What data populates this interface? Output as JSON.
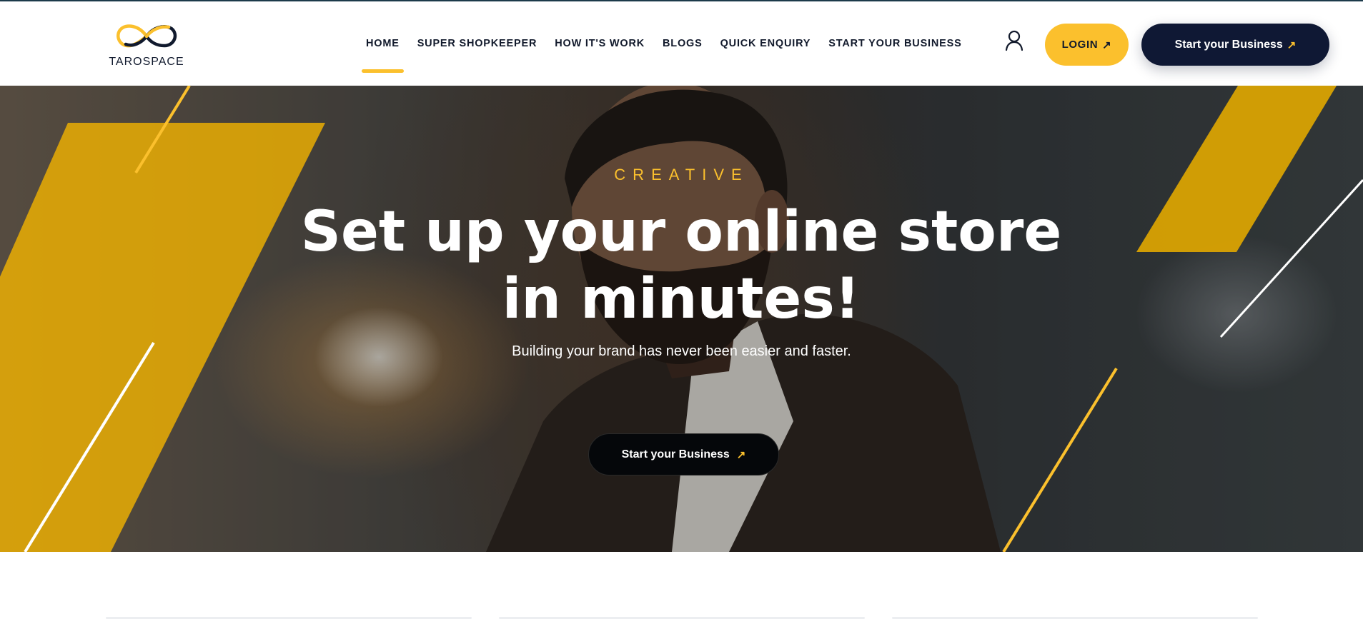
{
  "brand": {
    "name": "TAROSPACE",
    "colors": {
      "accent": "#fbc02d",
      "navy": "#0f1834"
    }
  },
  "nav": {
    "items": [
      {
        "label": "HOME",
        "active": true
      },
      {
        "label": "SUPER SHOPKEEPER",
        "active": false
      },
      {
        "label": "HOW IT'S WORK",
        "active": false
      },
      {
        "label": "BLOGS",
        "active": false
      },
      {
        "label": "QUICK ENQUIRY",
        "active": false
      },
      {
        "label": "START YOUR BUSINESS",
        "active": false
      }
    ]
  },
  "header": {
    "user_icon": "user-icon",
    "login_label": "LOGIN",
    "start_label": "Start your Business",
    "arrow_glyph": "↗"
  },
  "hero": {
    "eyebrow": "CREATIVE",
    "title": "Set up your online store in minutes!",
    "subtitle": "Building your brand has never been easier and faster.",
    "cta_label": "Start your Business"
  }
}
